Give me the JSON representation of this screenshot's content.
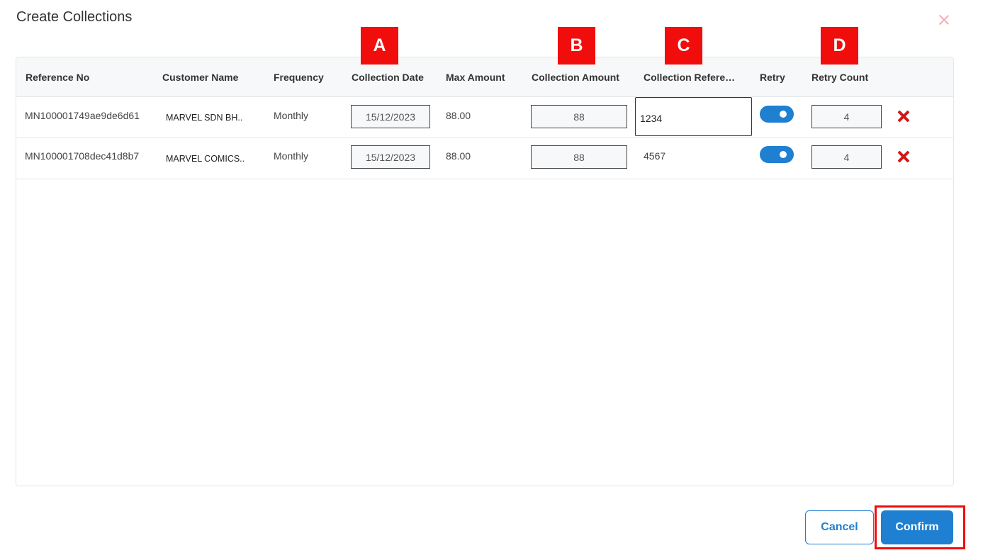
{
  "dialog": {
    "title": "Create Collections",
    "close_icon": "close-icon"
  },
  "markers": [
    "A",
    "B",
    "C",
    "D"
  ],
  "table": {
    "headers": [
      "Reference No",
      "Customer Name",
      "Frequency",
      "Collection Date",
      "Max Amount",
      "Collection Amount",
      "Collection Refere…",
      "Retry",
      "Retry Count"
    ],
    "rows": [
      {
        "reference_no": "MN100001749ae9de6d61",
        "customer_name": "MARVEL SDN BH..",
        "frequency": "Monthly",
        "collection_date": "15/12/2023",
        "max_amount": "88.00",
        "collection_amount": "88",
        "collection_reference": "1234",
        "retry": true,
        "retry_count": "4"
      },
      {
        "reference_no": "MN100001708dec41d8b7",
        "customer_name": "MARVEL COMICS..",
        "frequency": "Monthly",
        "collection_date": "15/12/2023",
        "max_amount": "88.00",
        "collection_amount": "88",
        "collection_reference": "4567",
        "retry": true,
        "retry_count": "4"
      }
    ]
  },
  "footer": {
    "cancel_label": "Cancel",
    "confirm_label": "Confirm"
  },
  "colors": {
    "primary": "#1f7fd1",
    "marker": "#f20d0d",
    "delete": "#d01818"
  }
}
